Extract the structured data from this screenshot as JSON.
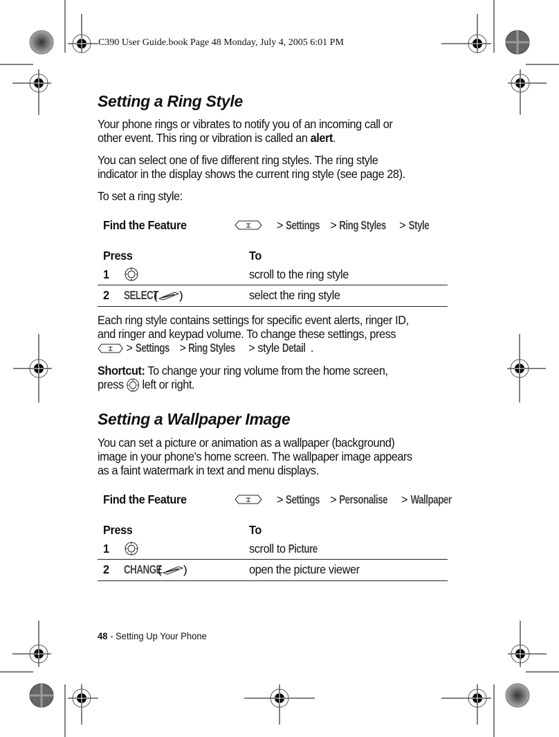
{
  "header": {
    "stamp": "C390 User Guide.book  Page 48  Monday, July 4, 2005  6:01 PM"
  },
  "section1": {
    "title": "Setting a Ring Style",
    "para1_line1": "Your phone rings or vibrates to notify you of an incoming call or",
    "para1_line2_pre": "other event. This ring or vibration is called an ",
    "para1_line2_bold": "alert",
    "para1_line2_post": ".",
    "para2_line1": "You can select one of five different ring styles. The ring style",
    "para2_line2": "indicator in the display shows the current ring style (see page 28).",
    "para3": "To set a ring style:",
    "find_feature": {
      "label": "Find the Feature",
      "icon": "menu-key-icon",
      "path": [
        ">",
        "Settings",
        ">",
        "Ring Styles",
        ">",
        "Style"
      ]
    },
    "table": {
      "headers": [
        "Press",
        "To"
      ],
      "rows": [
        {
          "num": "1",
          "press_icon": "nav-key-icon",
          "press_text": "",
          "to": "scroll to the ring style",
          "to_bold": ""
        },
        {
          "num": "2",
          "press_text": "SELECT",
          "press_icon": "soft-key-icon",
          "to": "select the ring style",
          "to_bold": ""
        }
      ]
    },
    "para4_line1": "Each ring style contains settings for specific event alerts, ringer ID,",
    "para4_line2": "and ringer and keypad volume. To change these settings, press",
    "para4_line3": {
      "sep1": " > ",
      "m1": "Settings",
      "sep2": " > ",
      "m2": "Ring Styles",
      "sep3": " > style ",
      "m3": "Detail",
      "end": "."
    },
    "shortcut_label": "Shortcut:",
    "shortcut_line1": " To change your ring volume from the home screen,",
    "shortcut_line2_pre": "press ",
    "shortcut_line2_post": " left or right."
  },
  "section2": {
    "title": "Setting a Wallpaper Image",
    "para1_line1": "You can set a picture or animation as a wallpaper (background)",
    "para1_line2": "image in your phone’s home screen. The wallpaper image appears",
    "para1_line3": "as a faint watermark in text and menu displays.",
    "find_feature": {
      "label": "Find the Feature",
      "icon": "menu-key-icon",
      "path": [
        ">",
        "Settings",
        ">",
        "Personalise",
        ">",
        "Wallpaper"
      ]
    },
    "table": {
      "headers": [
        "Press",
        "To"
      ],
      "rows": [
        {
          "num": "1",
          "press_icon": "nav-key-icon",
          "press_text": "",
          "to": "scroll to ",
          "to_bold": "Picture"
        },
        {
          "num": "2",
          "press_text": "CHANGE",
          "press_icon": "soft-key-icon",
          "to": "open the picture viewer",
          "to_bold": ""
        }
      ]
    }
  },
  "footer": {
    "page_number": "48",
    "section": " - Setting Up Your Phone"
  }
}
